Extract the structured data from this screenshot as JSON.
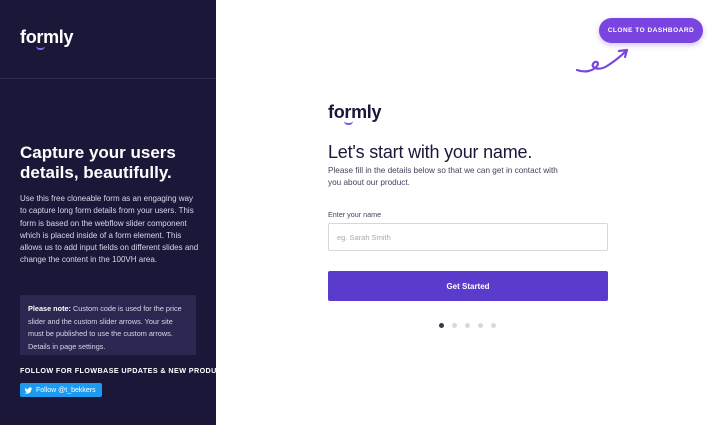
{
  "brand": {
    "logo_text": "formly",
    "accent": "#6c5ce7"
  },
  "left_panel": {
    "headline": "Capture your users details, beautifully.",
    "description": "Use this free cloneable form as an engaging way to capture long form details from your users. This form is based on the webflow slider component which is placed inside of a form element. This allows us to add input fields on different slides and change the content in the 100VH area.",
    "note": {
      "label": "Please note:",
      "text": " Custom code is used for the price slider and the custom slider arrows. Your site must be published to use the custom arrows. Details in page settings."
    },
    "follow_title": "FOLLOW FOR FLOWBASE UPDATES & NEW PRODUCTS",
    "twitter_button": {
      "icon": "twitter-bird-icon",
      "label": "Follow @t_bekkers"
    },
    "background": "#1b1738"
  },
  "header": {
    "clone_button": "CLONE TO DASHBOARD",
    "clone_color": "#7a44e0"
  },
  "form": {
    "title": "Let's start with your name.",
    "subtitle": "Please fill in the details below so that we can get in contact with you about our product.",
    "name_label": "Enter your name",
    "name_placeholder": "eg. Sarah Smith",
    "name_value": "",
    "submit_label": "Get Started",
    "submit_color": "#5a3bcb"
  },
  "slider": {
    "total_slides": 5,
    "active_slide": 1
  }
}
